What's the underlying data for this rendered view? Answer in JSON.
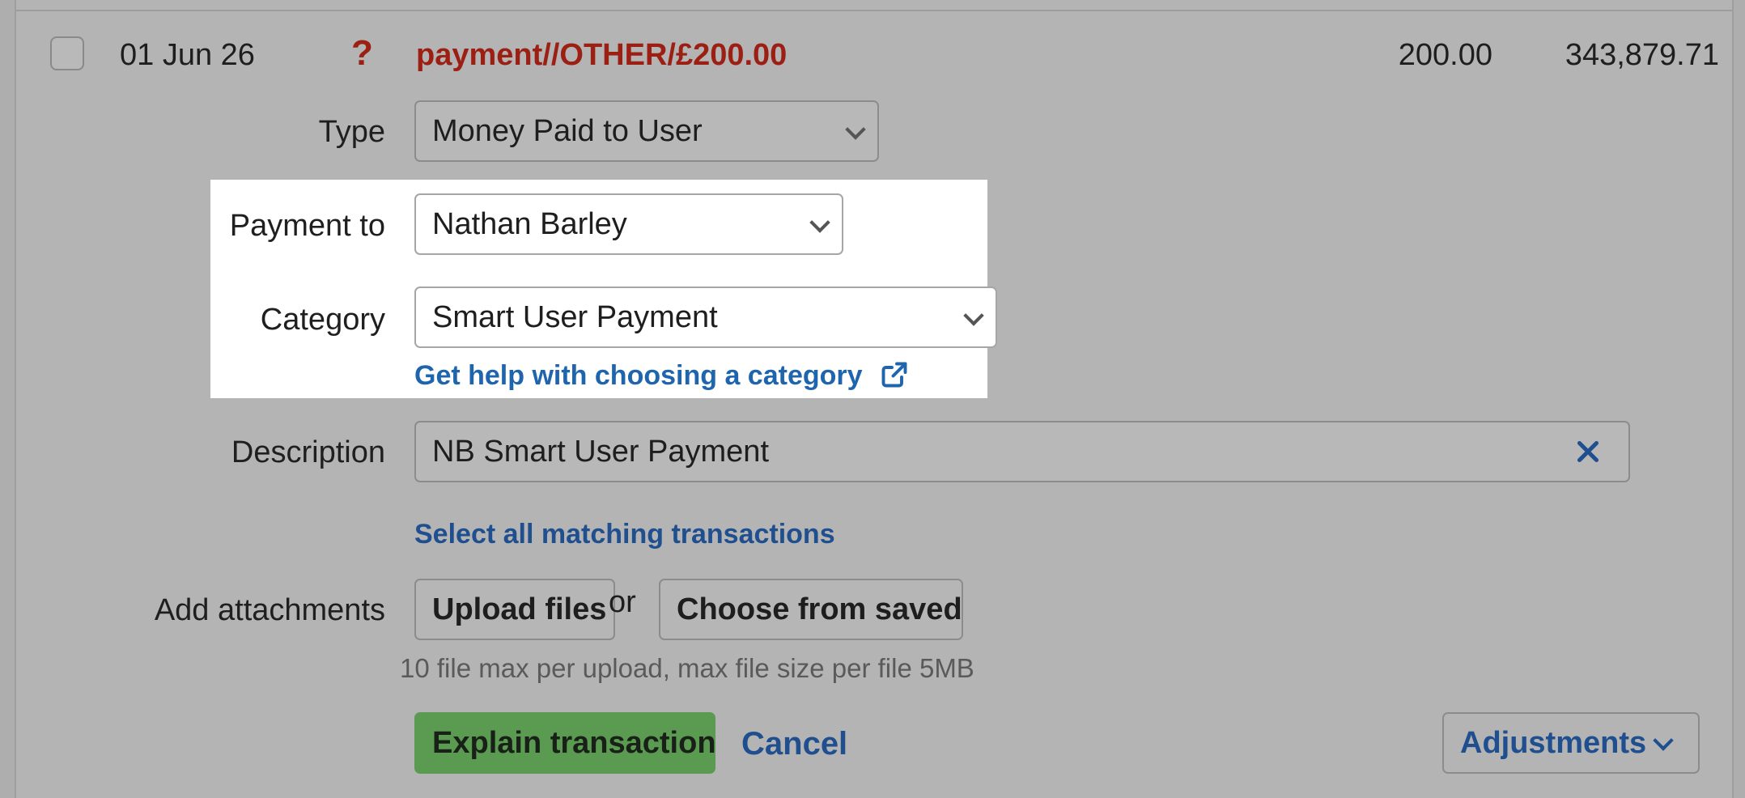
{
  "transaction": {
    "date": "01 Jun 26",
    "status_icon": "?",
    "reference": "payment//OTHER/£200.00",
    "amount": "200.00",
    "balance": "343,879.71"
  },
  "form": {
    "type_label": "Type",
    "type_value": "Money Paid to User",
    "payment_to_label": "Payment to",
    "payment_to_value": "Nathan Barley",
    "category_label": "Category",
    "category_value": "Smart User Payment",
    "category_help_link": "Get help with choosing a category",
    "description_label": "Description",
    "description_value": "NB Smart User Payment",
    "select_matching_link": "Select all matching transactions",
    "attachments_label": "Add attachments",
    "upload_button": "Upload files",
    "or_text": "or",
    "choose_saved_button": "Choose from saved",
    "attachments_hint": "10 file max per upload, max file size per file 5MB"
  },
  "actions": {
    "explain_button": "Explain transaction",
    "cancel_link": "Cancel",
    "adjustments_button": "Adjustments"
  },
  "colors": {
    "error_red": "#9c1f14",
    "link_blue": "#1f65ad",
    "primary_green": "#5b9a51"
  }
}
